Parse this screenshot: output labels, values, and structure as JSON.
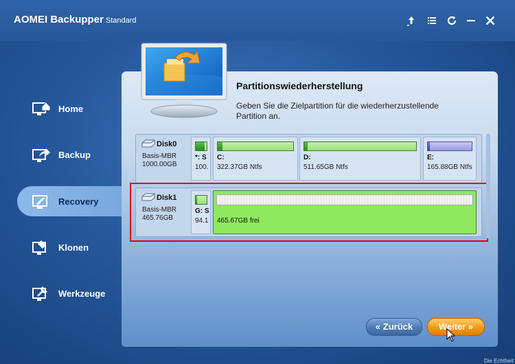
{
  "window": {
    "title": "AOMEI Backupper",
    "edition": "Standard"
  },
  "titlebar": {
    "icons": [
      "upgrade-icon",
      "menu-icon",
      "refresh-icon",
      "minimize-icon",
      "close-icon"
    ]
  },
  "sidebar": {
    "items": [
      {
        "label": "Home",
        "icon": "home-icon",
        "active": false
      },
      {
        "label": "Backup",
        "icon": "backup-icon",
        "active": false
      },
      {
        "label": "Recovery",
        "icon": "recovery-icon",
        "active": true
      },
      {
        "label": "Klonen",
        "icon": "clone-icon",
        "active": false
      },
      {
        "label": "Werkzeuge",
        "icon": "tools-icon",
        "active": false
      }
    ]
  },
  "panel": {
    "heading": "Partitionswiederherstellung",
    "description": "Geben Sie die Zielpartition für die wiederherzustellende Partition an."
  },
  "disks": [
    {
      "name": "Disk0",
      "type": "Basis-MBR",
      "size": "1000.00GB",
      "partitions": [
        {
          "label": "*: S",
          "size": "100.",
          "used": 0.8
        },
        {
          "label": "C:",
          "size": "322.37GB Ntfs",
          "used": 0.06
        },
        {
          "label": "D:",
          "size": "511.65GB Ntfs",
          "used": 0.03
        },
        {
          "label": "E:",
          "size": "165.88GB Ntfs",
          "used": 0.05
        }
      ]
    },
    {
      "name": "Disk1",
      "type": "Basis-MBR",
      "size": "465.76GB",
      "partitions": [
        {
          "label": "G: S",
          "size": "94.1",
          "used": 0.15
        },
        {
          "label": "",
          "size": "465.67GB frei",
          "used": 0
        }
      ]
    }
  ],
  "buttons": {
    "back": "« Zurück",
    "next": "Weiter »"
  },
  "corner_text": "Die Echtheit",
  "colors": {
    "accent_next": "#f39a14",
    "selection": "#e00010"
  }
}
